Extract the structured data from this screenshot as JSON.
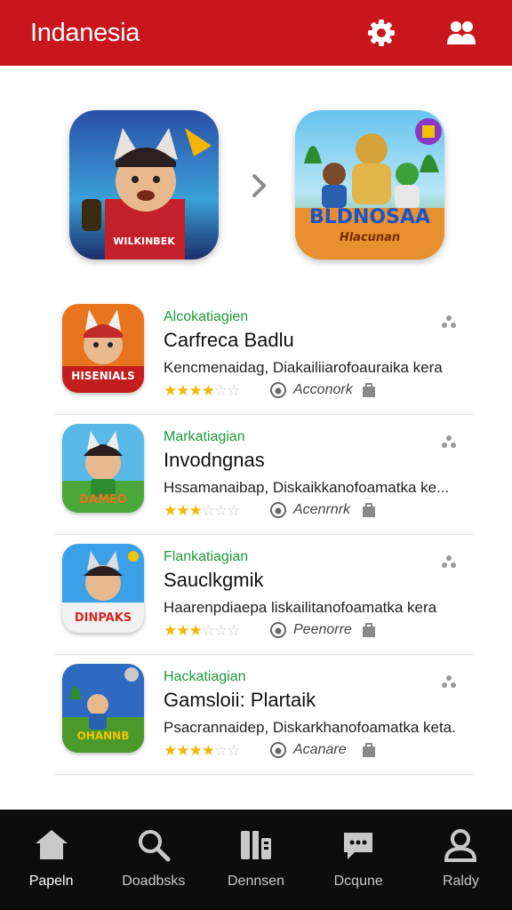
{
  "header": {
    "title": "Indanesia",
    "settings_icon": "gear-icon",
    "profile_icon": "users-icon",
    "color": "#c8161c"
  },
  "featured": [
    {
      "caption": "WILKINBEK"
    },
    {
      "caption": "BLDNOSAA",
      "subcaption": "Hlacunan"
    }
  ],
  "items": [
    {
      "category": "Alcokatiagien",
      "title": "Carfreca Badlu",
      "description": "Kencmenaidag, Diakailiiarofoauraika kera",
      "rating": 3.5,
      "badge": "Acconork",
      "thumb_caption": "HISENIALS"
    },
    {
      "category": "Markatiagian",
      "title": "Invodngnas",
      "description": "Hssamanaibap, Diskaikkanofoamatka ke...",
      "rating": 3,
      "badge": "Acenrnrk",
      "thumb_caption": "DAMEO"
    },
    {
      "category": "Flankatiagian",
      "title": "Sauclkgmik",
      "description": "Haarenpdiaepa liskailitanofoamatka kera",
      "rating": 3,
      "badge": "Peenorre",
      "thumb_caption": "DINPAKS"
    },
    {
      "category": "Hackatiagian",
      "title": "Gamsloii: Plartaik",
      "description": "Psacrannaidep, Diskarkhanofoamatka keta.",
      "rating": 3.5,
      "badge": "Acanare",
      "thumb_caption": "OHANNB"
    }
  ],
  "nav": [
    {
      "label": "Papeln",
      "icon": "home-icon",
      "active": true
    },
    {
      "label": "Doadbsks",
      "icon": "search-icon",
      "active": false
    },
    {
      "label": "Dennsen",
      "icon": "library-icon",
      "active": false
    },
    {
      "label": "Dcqune",
      "icon": "chat-icon",
      "active": false
    },
    {
      "label": "Raldy",
      "icon": "profile-icon",
      "active": false
    }
  ]
}
